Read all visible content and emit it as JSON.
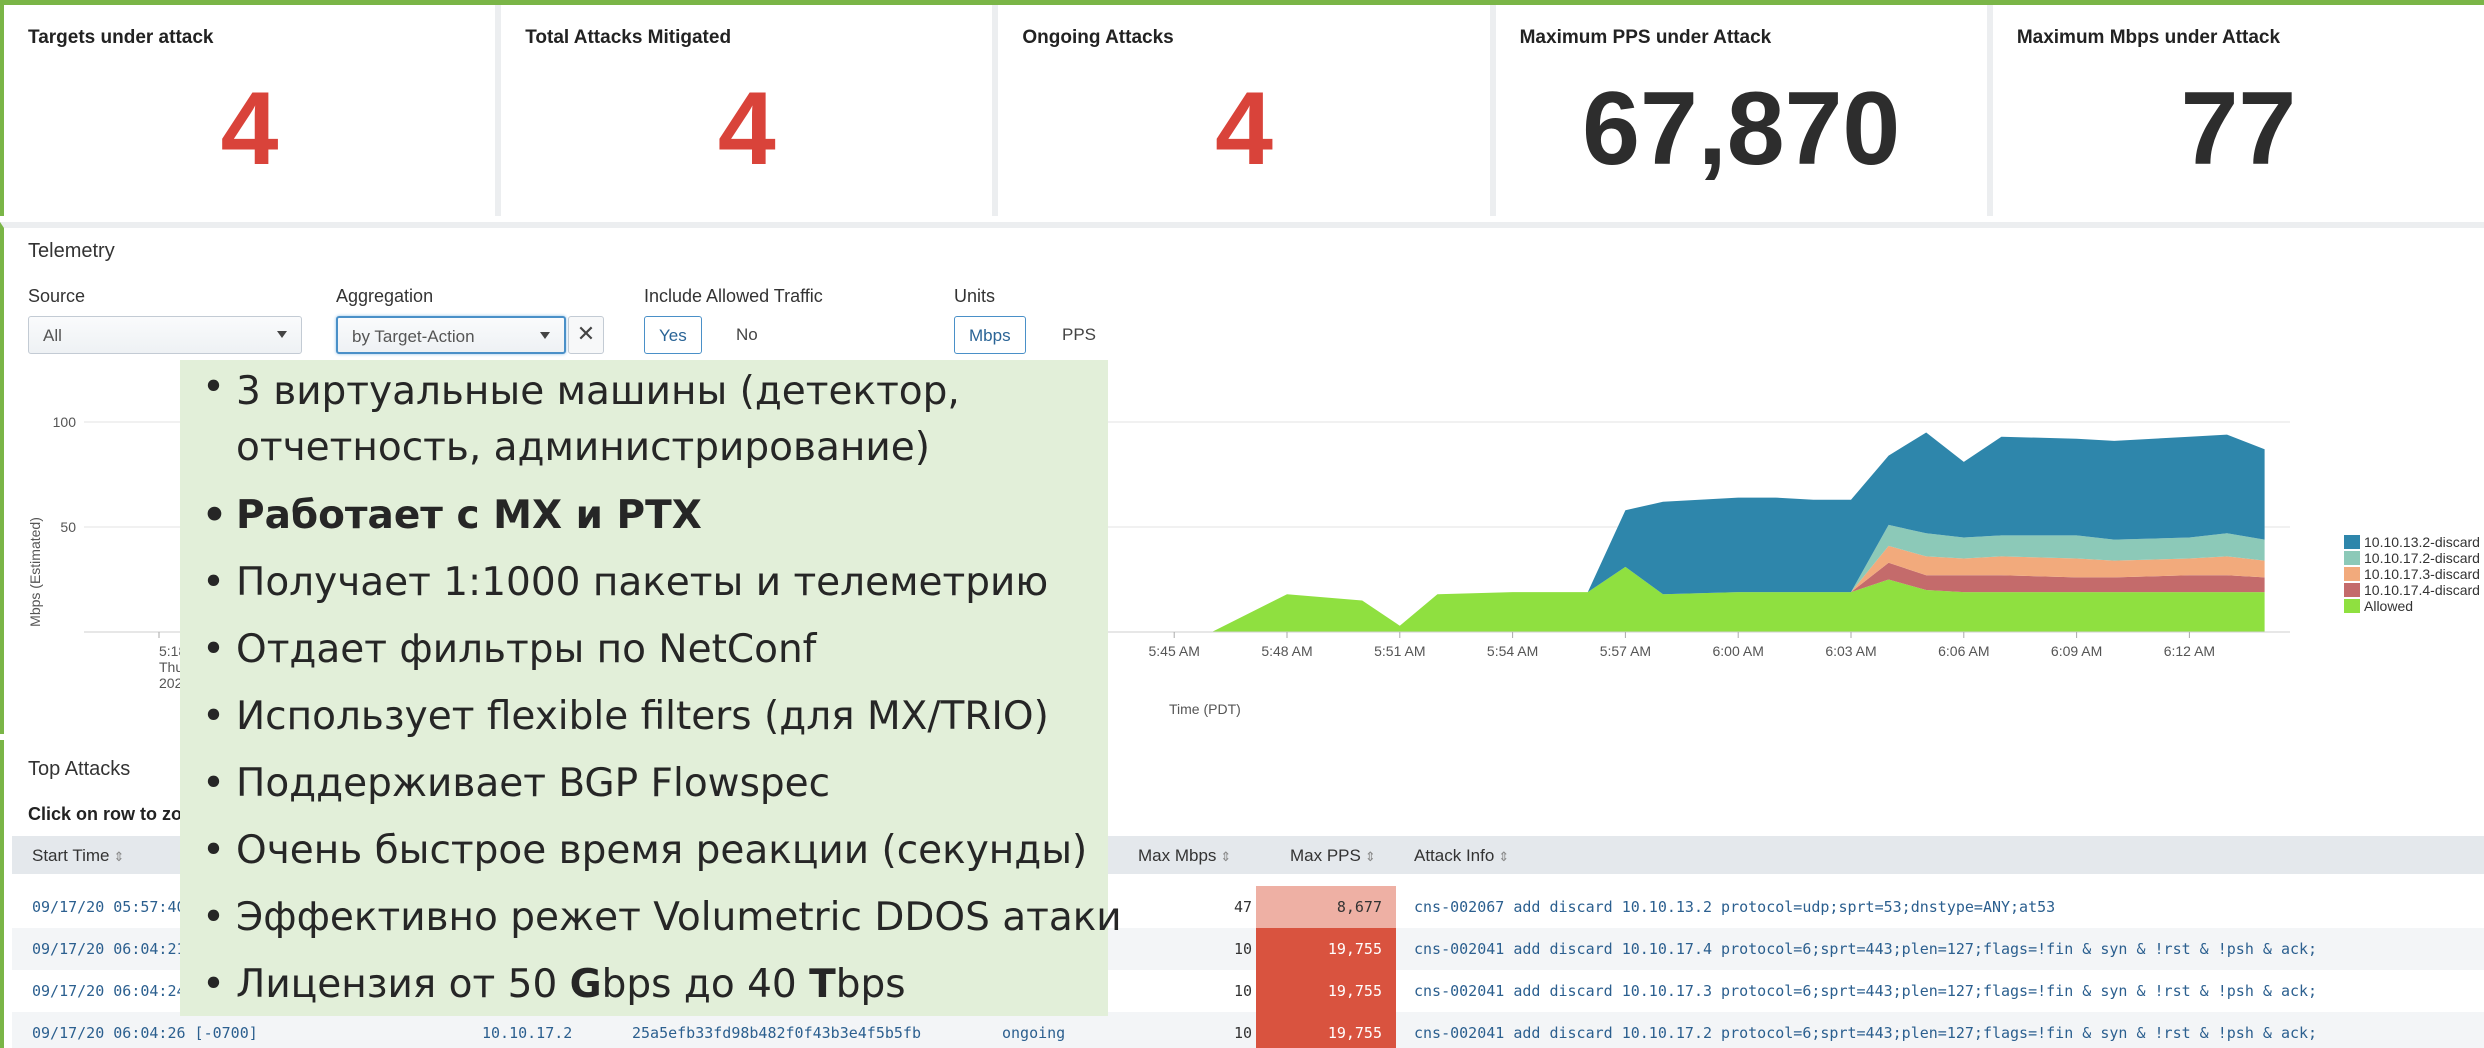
{
  "kpis": [
    {
      "title": "Targets under attack",
      "value": "4",
      "color": "#d9433a"
    },
    {
      "title": "Total Attacks Mitigated",
      "value": "4",
      "color": "#d9433a"
    },
    {
      "title": "Ongoing Attacks",
      "value": "4",
      "color": "#d9433a"
    },
    {
      "title": "Maximum PPS under Attack",
      "value": "67,870",
      "color": "#2d2d2d"
    },
    {
      "title": "Maximum Mbps under Attack",
      "value": "77",
      "color": "#2d2d2d"
    }
  ],
  "telemetry": {
    "title": "Telemetry",
    "source_label": "Source",
    "source_value": "All",
    "aggregation_label": "Aggregation",
    "aggregation_value": "by Target-Action",
    "clear_symbol": "✕",
    "allowed_label": "Include Allowed Traffic",
    "allowed_yes": "Yes",
    "allowed_no": "No",
    "units_label": "Units",
    "units_mbps": "Mbps",
    "units_pps": "PPS"
  },
  "chart_data": {
    "type": "area",
    "ylabel": "Mbps (Estimated)",
    "xlabel": "Time (PDT)",
    "yticks": [
      "100",
      "50"
    ],
    "ylim": [
      0,
      110
    ],
    "first_tick": [
      "5:18 AM",
      "Thu Se",
      "2020"
    ],
    "x": [
      "5:18 AM",
      "5:42 AM",
      "5:45 AM",
      "5:46 AM",
      "5:48 AM",
      "5:50 AM",
      "5:51 AM",
      "5:52 AM",
      "5:54 AM",
      "5:56 AM",
      "5:57 AM",
      "5:58 AM",
      "6:00 AM",
      "6:01 AM",
      "6:02 AM",
      "6:03 AM",
      "6:04 AM",
      "6:05 AM",
      "6:06 AM",
      "6:07 AM",
      "6:09 AM",
      "6:10 AM",
      "6:12 AM",
      "6:13 AM",
      "6:14 AM"
    ],
    "xtick_labels": [
      "5:45 AM",
      "5:48 AM",
      "5:51 AM",
      "5:54 AM",
      "5:57 AM",
      "6:00 AM",
      "6:03 AM",
      "6:06 AM",
      "6:09 AM",
      "6:12 AM"
    ],
    "series": [
      {
        "name": "Allowed",
        "color": "#8fe040",
        "values": [
          0,
          0,
          0,
          0,
          18,
          15,
          3,
          18,
          19,
          19,
          31,
          18,
          19,
          19,
          19,
          19,
          25,
          20,
          19,
          19,
          19,
          19,
          19,
          19,
          19
        ]
      },
      {
        "name": "10.10.17.4-discard",
        "color": "#c46b6b",
        "values": [
          0,
          0,
          0,
          0,
          0,
          0,
          0,
          0,
          0,
          0,
          0,
          0,
          0,
          0,
          0,
          0,
          8,
          7,
          8,
          8,
          7,
          7,
          8,
          8,
          7
        ]
      },
      {
        "name": "10.10.17.3-discard",
        "color": "#f2aa7c",
        "values": [
          0,
          0,
          0,
          0,
          0,
          0,
          0,
          0,
          0,
          0,
          0,
          0,
          0,
          0,
          0,
          0,
          8,
          9,
          8,
          9,
          9,
          8,
          8,
          9,
          8
        ]
      },
      {
        "name": "10.10.17.2-discard",
        "color": "#8cc9b8",
        "values": [
          0,
          0,
          0,
          0,
          0,
          0,
          0,
          0,
          0,
          0,
          0,
          0,
          0,
          0,
          0,
          0,
          10,
          11,
          10,
          10,
          11,
          10,
          10,
          11,
          10
        ]
      },
      {
        "name": "10.10.13.2-discard",
        "color": "#2e86ab",
        "values": [
          0,
          0,
          0,
          0,
          0,
          0,
          0,
          0,
          0,
          0,
          27,
          44,
          45,
          45,
          44,
          44,
          33,
          48,
          36,
          47,
          46,
          47,
          48,
          47,
          43
        ]
      }
    ],
    "legend": "right"
  },
  "attacks": {
    "title": "Top Attacks",
    "hint": "Click on row to zoo",
    "headers": {
      "start": "Start Time",
      "mbps": "Max Mbps",
      "pps": "Max PPS",
      "info": "Attack Info",
      "sort": "⇕"
    },
    "rows": [
      {
        "start": "09/17/20 05:57:40 [",
        "target": "",
        "hash": "",
        "status": "",
        "mbps": "47",
        "pps": "8,677",
        "pps_color": "#eeb0a4",
        "pps_text": "#333333",
        "info": "cns-002067 add discard  10.10.13.2 protocol=udp;sprt=53;dnstype=ANY;at53"
      },
      {
        "start": "09/17/20 06:04:21 [",
        "target": "",
        "hash": "",
        "status": "",
        "mbps": "10",
        "pps": "19,755",
        "pps_color": "#d9533f",
        "pps_text": "#ffffff",
        "info": "cns-002041 add discard  10.10.17.4 protocol=6;sprt=443;plen=127;flags=!fin & syn & !rst & !psh & ack;"
      },
      {
        "start": "09/17/20 06:04:24 [",
        "target": "",
        "hash": "",
        "status": "",
        "mbps": "10",
        "pps": "19,755",
        "pps_color": "#d9533f",
        "pps_text": "#ffffff",
        "info": "cns-002041 add discard  10.10.17.3 protocol=6;sprt=443;plen=127;flags=!fin & syn & !rst & !psh & ack;"
      },
      {
        "start": "09/17/20 06:04:26 [-0700]",
        "target": "10.10.17.2",
        "hash": "25a5efb33fd98b482f0f43b3e4f5b5fb",
        "status": "ongoing",
        "mbps": "10",
        "pps": "19,755",
        "pps_color": "#d9533f",
        "pps_text": "#ffffff",
        "info": "cns-002041 add discard  10.10.17.2 protocol=6;sprt=443;plen=127;flags=!fin & syn & !rst & !psh & ack;"
      }
    ]
  },
  "overlay": {
    "items": [
      {
        "text": "3 виртуальные машины (детектор, отчетность, администрирование)",
        "style": "two-line"
      },
      {
        "text": "Работает с MX и PTX",
        "style": "bold"
      },
      {
        "text": "Получает 1:1000 пакеты и телеметрию",
        "style": ""
      },
      {
        "text": "Отдает фильтры по NetConf",
        "style": ""
      },
      {
        "text": "Использует flexible filters (для MX/TRIO)",
        "style": ""
      },
      {
        "text": "Поддерживает BGP Flowspec",
        "style": ""
      },
      {
        "text": "Очень быстрое время реакции (секунды)",
        "style": ""
      },
      {
        "text": "Эффективно режет Volumetric DDOS атаки",
        "style": ""
      },
      {
        "rich": [
          [
            "Лицензия от 50 ",
            false
          ],
          [
            "G",
            true
          ],
          [
            "bps до 40 ",
            false
          ],
          [
            "T",
            true
          ],
          [
            "bps",
            false
          ]
        ],
        "style": ""
      }
    ]
  }
}
